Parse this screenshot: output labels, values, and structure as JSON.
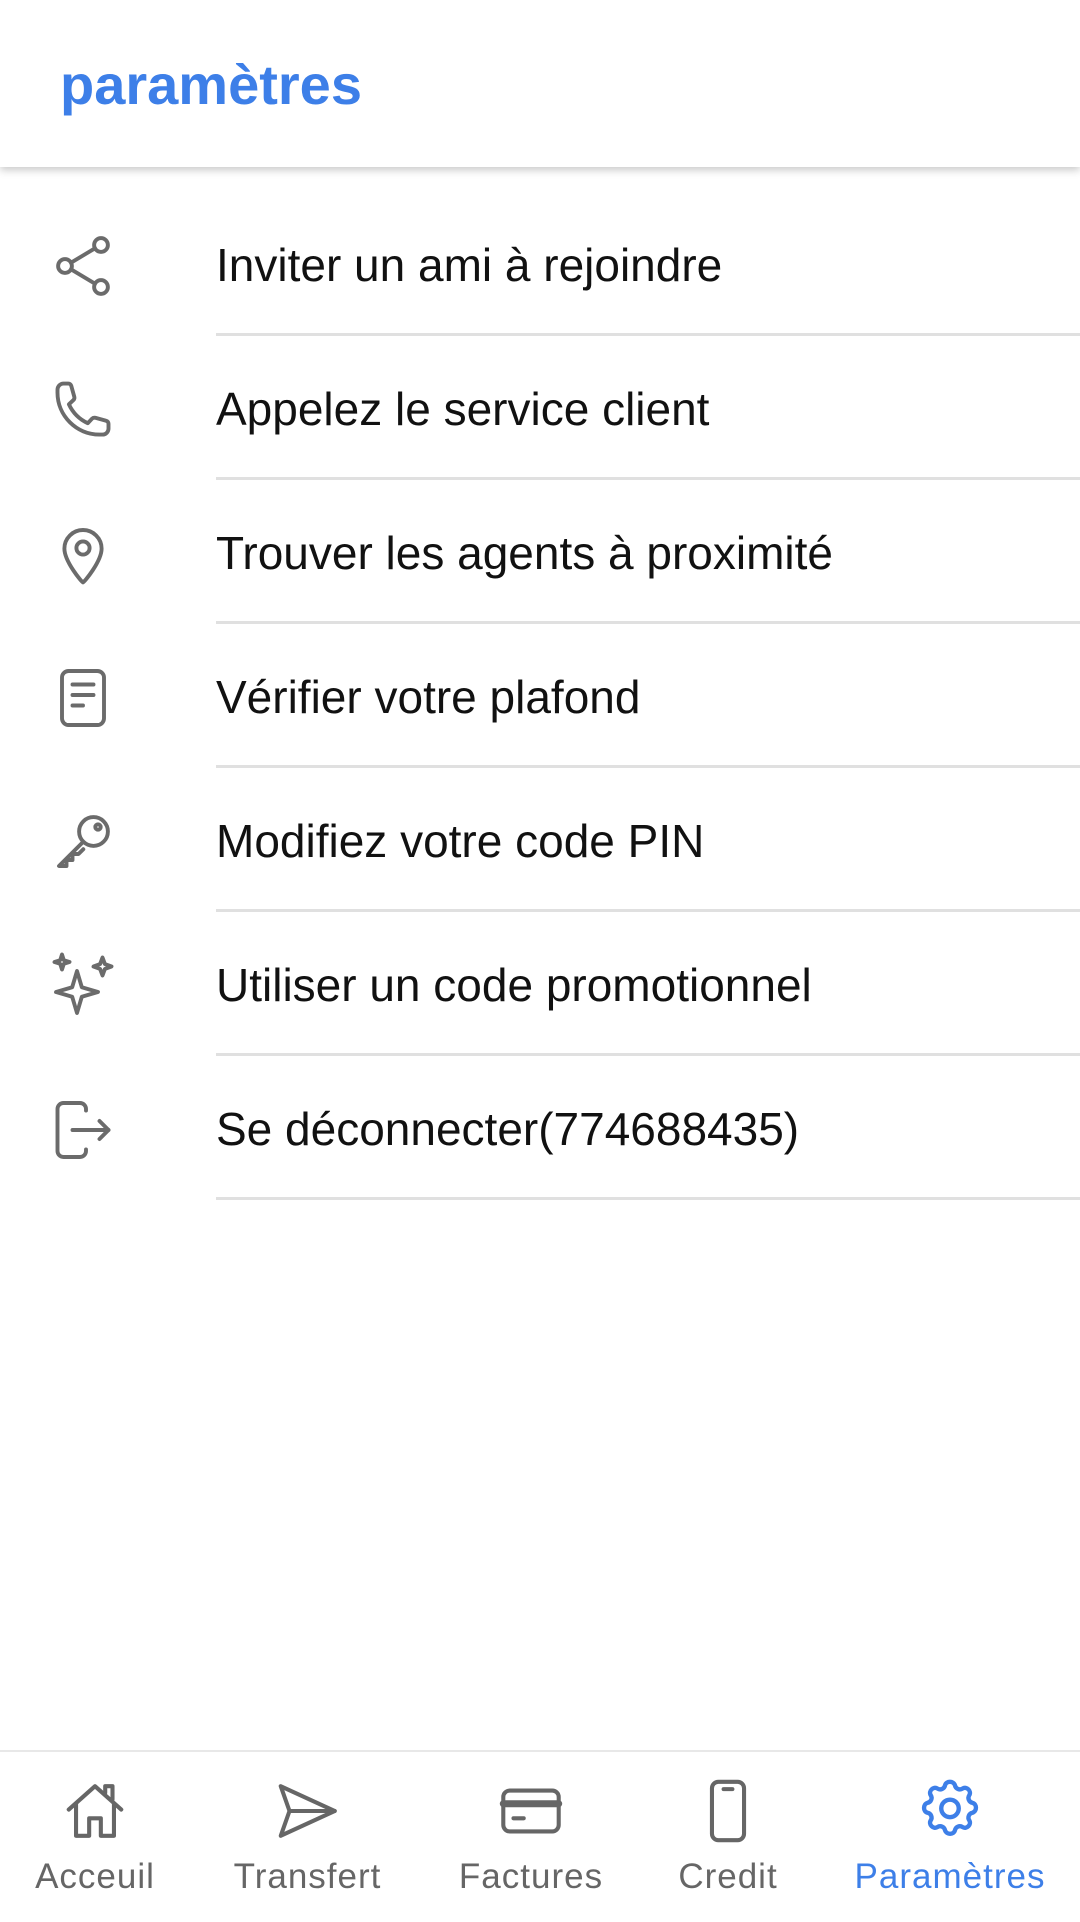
{
  "header": {
    "title": "paramètres"
  },
  "colors": {
    "accent": "#3d7fe8",
    "icon_gray": "#6b6b6b",
    "divider": "#e0e0e0"
  },
  "menu": {
    "items": [
      {
        "label": "Inviter un ami à rejoindre",
        "icon": "share-icon"
      },
      {
        "label": "Appelez le service client",
        "icon": "phone-icon"
      },
      {
        "label": "Trouver les agents à proximité",
        "icon": "location-pin-icon"
      },
      {
        "label": "Vérifier votre plafond",
        "icon": "document-icon"
      },
      {
        "label": "Modifiez votre code PIN",
        "icon": "key-icon"
      },
      {
        "label": "Utiliser un code promotionnel",
        "icon": "sparkles-icon"
      },
      {
        "label": "Se déconnecter(774688435)",
        "icon": "logout-icon"
      }
    ]
  },
  "bottom_nav": {
    "items": [
      {
        "label": "Acceuil",
        "icon": "home-icon",
        "active": false
      },
      {
        "label": "Transfert",
        "icon": "send-icon",
        "active": false
      },
      {
        "label": "Factures",
        "icon": "credit-card-icon",
        "active": false
      },
      {
        "label": "Credit",
        "icon": "mobile-phone-icon",
        "active": false
      },
      {
        "label": "Paramètres",
        "icon": "gear-icon",
        "active": true
      }
    ]
  }
}
